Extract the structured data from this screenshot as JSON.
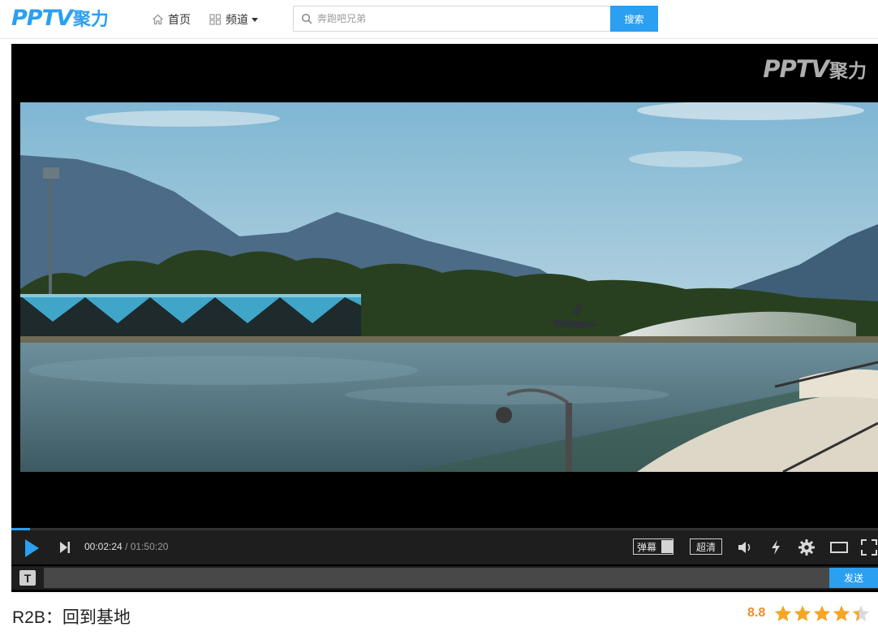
{
  "header": {
    "logo_latin": "PPTV",
    "logo_cn": "聚力",
    "nav": [
      {
        "label": "首页",
        "icon": "home-icon"
      },
      {
        "label": "频道",
        "icon": "grid-icon"
      }
    ],
    "search": {
      "placeholder": "奔跑吧兄弟",
      "button_label": "搜索"
    }
  },
  "player": {
    "watermark_latin": "PPTV",
    "watermark_cn": "聚力",
    "progress_fraction": 0.0219,
    "time_current": "00:02:24",
    "time_separator": "/",
    "time_total": "01:50:20",
    "danmu_toggle_label": "弹幕",
    "quality_label": "超清",
    "danmu_placeholder": "",
    "danmu_type_icon_label": "T",
    "send_label": "发送"
  },
  "video": {
    "title": "R2B：回到基地",
    "score": "8.8",
    "stars_value": 4.4,
    "stars_max": 5
  },
  "colors": {
    "brand": "#2b9ff0",
    "score": "#f28c28",
    "star": "#f5a623"
  }
}
